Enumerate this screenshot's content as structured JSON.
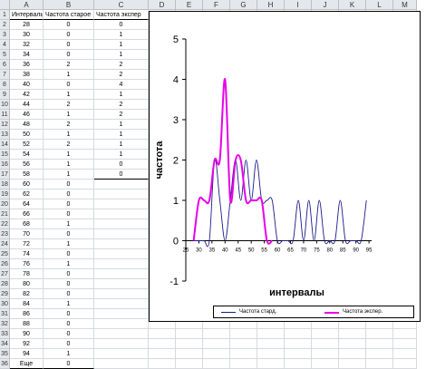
{
  "spreadsheet": {
    "column_letters": [
      "A",
      "B",
      "C",
      "D",
      "E",
      "F",
      "G",
      "H",
      "I",
      "J",
      "K",
      "L",
      "M"
    ],
    "headers": [
      "Интервалы",
      "Частота старое",
      "Частота экспер"
    ],
    "rows": [
      [
        "28",
        "0",
        "0"
      ],
      [
        "30",
        "0",
        "1"
      ],
      [
        "32",
        "0",
        "1"
      ],
      [
        "34",
        "0",
        "1"
      ],
      [
        "36",
        "2",
        "2"
      ],
      [
        "38",
        "1",
        "2"
      ],
      [
        "40",
        "0",
        "4"
      ],
      [
        "42",
        "1",
        "1"
      ],
      [
        "44",
        "2",
        "2"
      ],
      [
        "46",
        "1",
        "2"
      ],
      [
        "48",
        "2",
        "1"
      ],
      [
        "50",
        "1",
        "1"
      ],
      [
        "52",
        "2",
        "1"
      ],
      [
        "54",
        "1",
        "1"
      ],
      [
        "56",
        "1",
        "0"
      ],
      [
        "58",
        "1",
        "0"
      ],
      [
        "60",
        "0",
        ""
      ],
      [
        "62",
        "0",
        ""
      ],
      [
        "64",
        "0",
        ""
      ],
      [
        "66",
        "0",
        ""
      ],
      [
        "68",
        "1",
        ""
      ],
      [
        "70",
        "0",
        ""
      ],
      [
        "72",
        "1",
        ""
      ],
      [
        "74",
        "0",
        ""
      ],
      [
        "76",
        "1",
        ""
      ],
      [
        "78",
        "0",
        ""
      ],
      [
        "80",
        "0",
        ""
      ],
      [
        "82",
        "0",
        ""
      ],
      [
        "84",
        "1",
        ""
      ],
      [
        "86",
        "0",
        ""
      ],
      [
        "88",
        "0",
        ""
      ],
      [
        "90",
        "0",
        ""
      ],
      [
        "92",
        "0",
        ""
      ],
      [
        "94",
        "1",
        ""
      ],
      [
        "Еще",
        "0",
        ""
      ]
    ]
  },
  "chart_data": {
    "type": "line",
    "title": "",
    "xlabel": "интервалы",
    "ylabel": "частота",
    "ylim": [
      -1,
      5
    ],
    "yticks": [
      "5",
      "4",
      "3",
      "2",
      "1",
      "0",
      "-1"
    ],
    "xlim": [
      25,
      96
    ],
    "xticks": [
      "25",
      "30",
      "35",
      "40",
      "45",
      "50",
      "55",
      "60",
      "65",
      "70",
      "75",
      "80",
      "85",
      "90",
      "95"
    ],
    "grid": false,
    "legend_position": "bottom",
    "series": [
      {
        "name": "Частота стард.",
        "color": "#1a1a8a",
        "x": [
          28,
          30,
          32,
          34,
          36,
          38,
          40,
          42,
          44,
          46,
          48,
          50,
          52,
          54,
          56,
          58,
          60,
          62,
          64,
          66,
          68,
          70,
          72,
          74,
          76,
          78,
          80,
          82,
          84,
          86,
          88,
          90,
          92,
          94
        ],
        "y": [
          0,
          0,
          0,
          0,
          2,
          1,
          0,
          1,
          2,
          1,
          2,
          1,
          2,
          1,
          1,
          1,
          0,
          0,
          0,
          0,
          1,
          0,
          1,
          0,
          1,
          0,
          0,
          0,
          1,
          0,
          0,
          0,
          0,
          1
        ]
      },
      {
        "name": "Частота экспер.",
        "color": "#e800e8",
        "x": [
          28,
          30,
          32,
          34,
          36,
          38,
          40,
          42,
          44,
          46,
          48,
          50,
          52,
          54,
          56,
          58
        ],
        "y": [
          0,
          1,
          1,
          1,
          2,
          2,
          4,
          1,
          2,
          2,
          1,
          1,
          1,
          1,
          0,
          0
        ]
      }
    ]
  }
}
